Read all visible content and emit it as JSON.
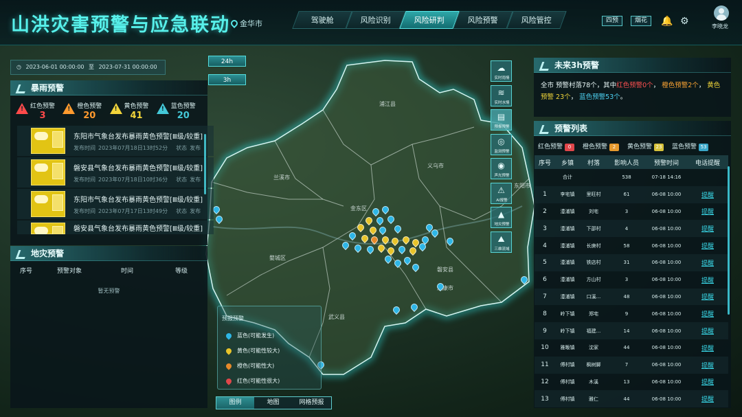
{
  "header": {
    "title": "山洪灾害预警与应急联动",
    "city": "金华市",
    "nav": [
      "驾驶舱",
      "风险识别",
      "风险研判",
      "风险预警",
      "风险管控"
    ],
    "active_nav": 2,
    "btn_a": "四预",
    "btn_b": "烟花",
    "username": "李晓龙"
  },
  "date_range": {
    "start": "2023-06-01 00:00:00",
    "sep": "至",
    "end": "2023-07-31 00:00:00"
  },
  "time_buttons": [
    "24h",
    "3h"
  ],
  "rain_panel": {
    "title": "暴雨预警",
    "levels": [
      {
        "name": "红色预警",
        "count": "3",
        "color": "#ff4a4a"
      },
      {
        "name": "橙色预警",
        "count": "20",
        "color": "#ff9a2e"
      },
      {
        "name": "黄色预警",
        "count": "41",
        "color": "#f2d43a"
      },
      {
        "name": "蓝色预警",
        "count": "20",
        "color": "#44c8d8"
      }
    ],
    "items": [
      {
        "title": "东阳市气象台发布暴雨黄色预警[Ⅲ级/较重]",
        "time_label": "发布时间",
        "time": "2023年07月18日13时52分",
        "status_label": "状态",
        "status": "发布"
      },
      {
        "title": "磐安县气象台发布暴雨黄色预警[Ⅲ级/较重]",
        "time_label": "发布时间",
        "time": "2023年07月18日10时36分",
        "status_label": "状态",
        "status": "发布"
      },
      {
        "title": "东阳市气象台发布暴雨黄色预警[Ⅲ级/较重]",
        "time_label": "发布时间",
        "time": "2023年07月17日13时49分",
        "status_label": "状态",
        "status": "发布"
      },
      {
        "title": "磐安县气象台发布暴雨黄色预警[Ⅲ级/较重]",
        "time_label": "发布时间",
        "time": "2023年07月17日12时07分",
        "status_label": "状态",
        "status": "发布"
      }
    ]
  },
  "geo_panel": {
    "title": "地灾预警",
    "columns": [
      "序号",
      "预警对象",
      "时间",
      "等级"
    ],
    "empty": "暂无预警"
  },
  "forecast_panel": {
    "title": "未来3h预警",
    "s1": "全市 预警村落78个，其中",
    "red": "红色预警0个",
    "orange": "橙色预警2个",
    "yellow": "黄色预警",
    "yellow2": "23个",
    "blue": "蓝色预警53个",
    "end": "。"
  },
  "list_panel": {
    "title": "预警列表",
    "badges": [
      {
        "name": "红色预警",
        "count": "0",
        "color": "#e0464a"
      },
      {
        "name": "橙色预警",
        "count": "2",
        "color": "#e69a2e"
      },
      {
        "name": "黄色预警",
        "count": "23",
        "color": "#d7c23a"
      },
      {
        "name": "蓝色预警",
        "count": "53",
        "color": "#3aa7c8"
      }
    ],
    "columns": [
      "序号",
      "乡镇",
      "村落",
      "影响人员",
      "预警时间",
      "电话提醒"
    ],
    "total": {
      "label": "合计",
      "people": "538",
      "time": "07-18 14:16"
    },
    "rows": [
      {
        "no": "1",
        "town": "李宅镇",
        "village": "里旺村",
        "people": "61",
        "time": "06-08 10:00",
        "action": "提醒"
      },
      {
        "no": "2",
        "town": "澧浦镇",
        "village": "刘宅",
        "people": "3",
        "time": "06-08 10:00",
        "action": "提醒"
      },
      {
        "no": "3",
        "town": "澧浦镇",
        "village": "下邵村",
        "people": "4",
        "time": "06-08 10:00",
        "action": "提醒"
      },
      {
        "no": "4",
        "town": "澧浦镇",
        "village": "长庚村",
        "people": "58",
        "time": "06-08 10:00",
        "action": "提醒"
      },
      {
        "no": "5",
        "town": "澧浦镇",
        "village": "铁店村",
        "people": "31",
        "time": "06-08 10:00",
        "action": "提醒"
      },
      {
        "no": "6",
        "town": "澧浦镇",
        "village": "方山村",
        "people": "3",
        "time": "06-08 10:00",
        "action": "提醒"
      },
      {
        "no": "7",
        "town": "澧浦镇",
        "village": "口溪...",
        "people": "48",
        "time": "06-08 10:00",
        "action": "提醒"
      },
      {
        "no": "8",
        "town": "岭下镇",
        "village": "郑宅",
        "people": "9",
        "time": "06-08 10:00",
        "action": "提醒"
      },
      {
        "no": "9",
        "town": "岭下镇",
        "village": "福建...",
        "people": "14",
        "time": "06-08 10:00",
        "action": "提醒"
      },
      {
        "no": "10",
        "town": "雅畈镇",
        "village": "沈家",
        "people": "44",
        "time": "06-08 10:00",
        "action": "提醒"
      },
      {
        "no": "11",
        "town": "傅村镇",
        "village": "枫树脚",
        "people": "7",
        "time": "06-08 10:00",
        "action": "提醒"
      },
      {
        "no": "12",
        "town": "傅村镇",
        "village": "木溪",
        "people": "13",
        "time": "06-08 10:00",
        "action": "提醒"
      },
      {
        "no": "13",
        "town": "傅村镇",
        "village": "雅仁",
        "people": "44",
        "time": "06-08 10:00",
        "action": "提醒"
      }
    ]
  },
  "map_tools": [
    {
      "label": "实时雨情",
      "icon": "rain-cloud-icon"
    },
    {
      "label": "实时水情",
      "icon": "water-level-icon"
    },
    {
      "label": "预报预警",
      "icon": "forecast-icon"
    },
    {
      "label": "监测预警",
      "icon": "monitor-icon"
    },
    {
      "label": "声光预警",
      "icon": "alarm-light-icon"
    },
    {
      "label": "AI报警",
      "icon": "ai-alarm-icon"
    },
    {
      "label": "地灾预警",
      "icon": "landslide-icon"
    },
    {
      "label": "三维流域",
      "icon": "basin-3d-icon"
    }
  ],
  "map_legend": {
    "title": "预报预警",
    "items": [
      {
        "label": "蓝色(可能发生)",
        "color": "#2eb6e6"
      },
      {
        "label": "黄色(可能性较大)",
        "color": "#e8c42a"
      },
      {
        "label": "橙色(可能性大)",
        "color": "#e6892a"
      },
      {
        "label": "红色(可能性很大)",
        "color": "#e0474a"
      }
    ]
  },
  "map_tabs": [
    "图例",
    "地图",
    "网格预报"
  ],
  "map_places": [
    "浦江县",
    "兰溪市",
    "义乌市",
    "金东区",
    "婺城区",
    "武义县",
    "东阳市",
    "永康市",
    "磐安县"
  ]
}
